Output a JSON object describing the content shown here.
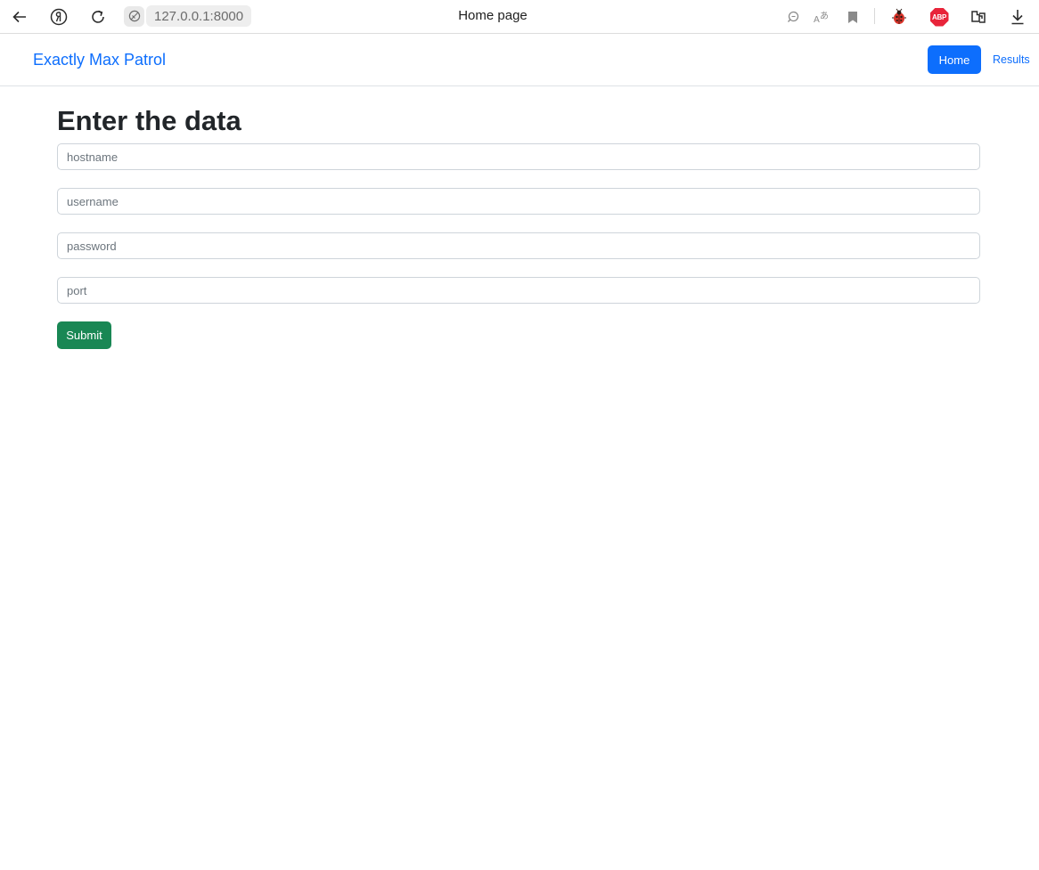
{
  "browser": {
    "url": "127.0.0.1:8000",
    "tab_title": "Home page",
    "icons": [
      "back-arrow-icon",
      "yandex-icon",
      "reload-icon",
      "site-info-icon",
      "comment-icon",
      "translate-icon",
      "bookmark-icon",
      "ladybug-extension-icon",
      "adblock-plus-icon",
      "extensions-icon",
      "download-icon"
    ],
    "adblock_label": "ABP"
  },
  "navbar": {
    "brand": "Exactly Max Patrol",
    "links": [
      {
        "label": "Home",
        "active": true
      },
      {
        "label": "Results",
        "active": false
      }
    ]
  },
  "main": {
    "title": "Enter the data",
    "fields": [
      {
        "name": "hostname",
        "placeholder": "hostname",
        "value": ""
      },
      {
        "name": "username",
        "placeholder": "username",
        "value": ""
      },
      {
        "name": "password",
        "placeholder": "password",
        "value": ""
      },
      {
        "name": "port",
        "placeholder": "port",
        "value": ""
      }
    ],
    "submit_label": "Submit"
  },
  "colors": {
    "primary": "#0d6efd",
    "success": "#198754",
    "text": "#212529",
    "abp_red": "#e8243a"
  }
}
